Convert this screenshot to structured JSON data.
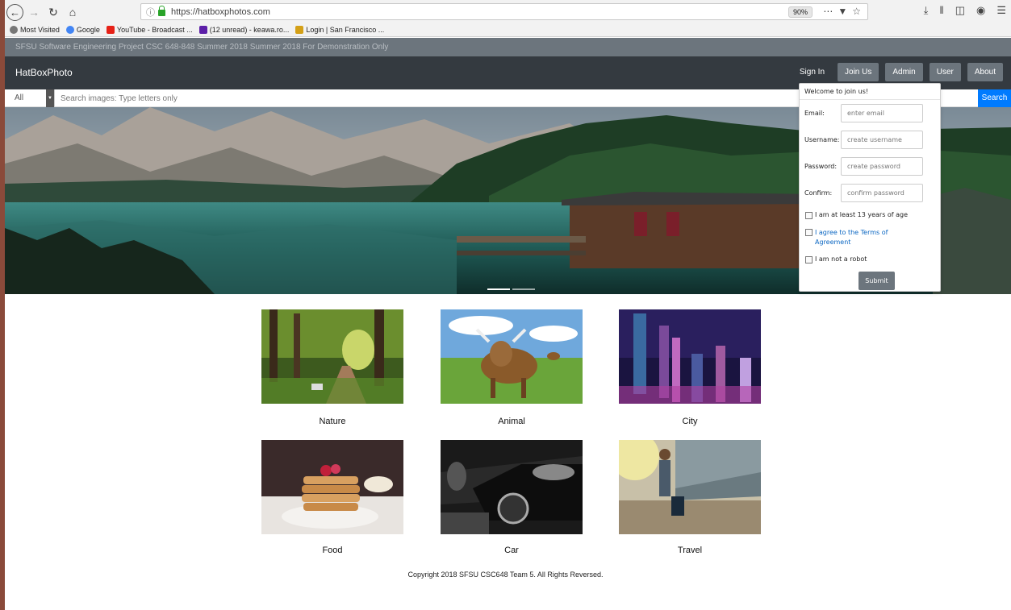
{
  "browser": {
    "url": "https://hatboxphotos.com",
    "zoom": "90%",
    "bookmarks": [
      {
        "label": "Most Visited",
        "color": "#777777"
      },
      {
        "label": "Google",
        "color": "#4285f4"
      },
      {
        "label": "YouTube - Broadcast ...",
        "color": "#e62117"
      },
      {
        "label": "(12 unread) - keawa.ro...",
        "color": "#5c1fa8"
      },
      {
        "label": "Login | San Francisco ...",
        "color": "#d4a017"
      }
    ]
  },
  "banner": {
    "text": "SFSU Software Engineering Project CSC 648-848 Summer 2018 Summer 2018 For Demonstration Only"
  },
  "navbar": {
    "brand": "HatBoxPhoto",
    "links": {
      "sign_in": "Sign In",
      "join_us": "Join Us",
      "admin": "Admin",
      "user": "User",
      "about": "About"
    }
  },
  "search": {
    "category": "All",
    "placeholder": "Search images: Type letters only",
    "button": "Search"
  },
  "join_form": {
    "title": "Welcome to join us!",
    "email_label": "Email:",
    "email_placeholder": "enter email",
    "username_label": "Username:",
    "username_placeholder": "create username",
    "password_label": "Password:",
    "password_placeholder": "create password",
    "confirm_label": "Confirm:",
    "confirm_placeholder": "confirm password",
    "age_check": "I am at least 13 years of age",
    "terms_check": "I agree to the Terms of Agreement",
    "robot_check": "I am not a robot",
    "submit": "Submit"
  },
  "categories": [
    {
      "label": "Nature"
    },
    {
      "label": "Animal"
    },
    {
      "label": "City"
    },
    {
      "label": "Food"
    },
    {
      "label": "Car"
    },
    {
      "label": "Travel"
    }
  ],
  "footer": {
    "text": "Copyright 2018 SFSU CSC648 Team 5. All Rights Reversed."
  }
}
